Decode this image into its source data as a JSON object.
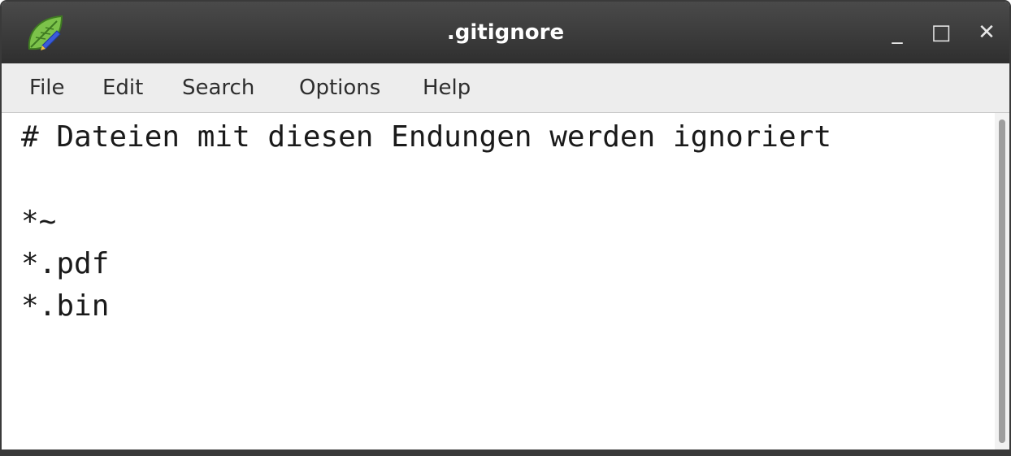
{
  "window": {
    "title": ".gitignore",
    "controls": {
      "minimize": "_",
      "maximize": "□",
      "close": "✕"
    },
    "app_icon": "leaf-pen-icon"
  },
  "menubar": {
    "items": [
      {
        "label": "File"
      },
      {
        "label": "Edit"
      },
      {
        "label": "Search"
      },
      {
        "label": "Options"
      },
      {
        "label": "Help"
      }
    ]
  },
  "editor": {
    "lines": [
      "# Dateien mit diesen Endungen werden ignoriert",
      "",
      "*~",
      "*.pdf",
      "*.bin"
    ]
  },
  "colors": {
    "titlebar": "#3a3a3a",
    "menubar": "#ededed",
    "icon_leaf": "#6ab04c"
  }
}
